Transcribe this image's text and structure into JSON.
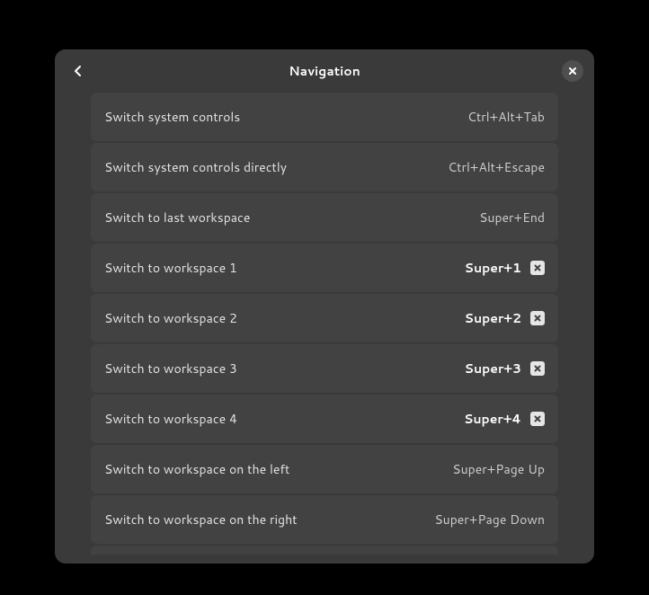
{
  "header": {
    "title": "Navigation"
  },
  "shortcuts": [
    {
      "label": "Switch system controls",
      "key": "Ctrl+Alt+Tab",
      "modified": false
    },
    {
      "label": "Switch system controls directly",
      "key": "Ctrl+Alt+Escape",
      "modified": false
    },
    {
      "label": "Switch to last workspace",
      "key": "Super+End",
      "modified": false
    },
    {
      "label": "Switch to workspace 1",
      "key": "Super+1",
      "modified": true
    },
    {
      "label": "Switch to workspace 2",
      "key": "Super+2",
      "modified": true
    },
    {
      "label": "Switch to workspace 3",
      "key": "Super+3",
      "modified": true
    },
    {
      "label": "Switch to workspace 4",
      "key": "Super+4",
      "modified": true
    },
    {
      "label": "Switch to workspace on the left",
      "key": "Super+Page Up",
      "modified": false
    },
    {
      "label": "Switch to workspace on the right",
      "key": "Super+Page Down",
      "modified": false
    }
  ]
}
